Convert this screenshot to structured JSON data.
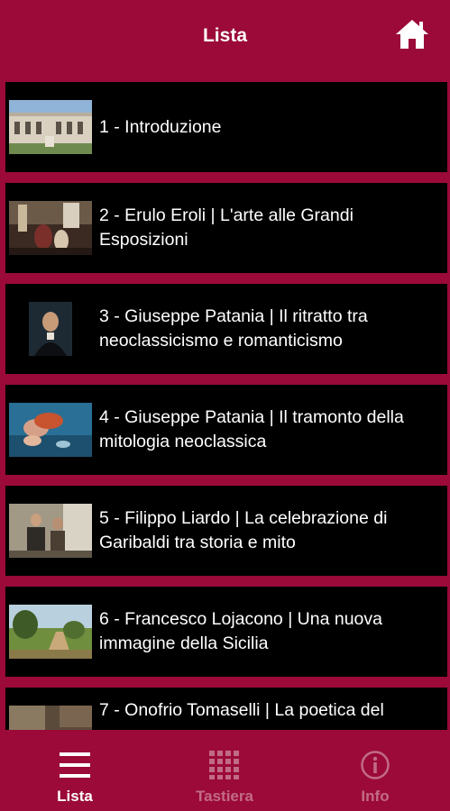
{
  "header": {
    "title": "Lista",
    "home_icon": "home-icon"
  },
  "list": {
    "items": [
      {
        "label": "1 - Introduzione",
        "thumbnail": "cloister-courtyard"
      },
      {
        "label": "2 - Erulo Eroli | L'arte alle Grandi Esposizioni",
        "thumbnail": "painting-interior-scene"
      },
      {
        "label": "3 - Giuseppe Patania | Il ritratto tra neoclassicismo e romanticismo",
        "thumbnail": "portrait-painting"
      },
      {
        "label": "4 - Giuseppe Patania | Il tramonto della mitologia neoclassica",
        "thumbnail": "mythological-painting"
      },
      {
        "label": "5 - Filippo Liardo | La celebrazione di Garibaldi tra storia e mito",
        "thumbnail": "garibaldi-painting"
      },
      {
        "label": "6 - Francesco Lojacono | Una nuova immagine della Sicilia",
        "thumbnail": "landscape-painting"
      },
      {
        "label": "7 - Onofrio Tomaselli | La poetica del",
        "thumbnail": "genre-painting"
      }
    ]
  },
  "bottom_nav": {
    "tabs": [
      {
        "label": "Lista",
        "icon": "list-icon",
        "active": true
      },
      {
        "label": "Tastiera",
        "icon": "keypad-icon",
        "active": false
      },
      {
        "label": "Info",
        "icon": "info-icon",
        "active": false
      }
    ]
  },
  "colors": {
    "brand": "#9b0a38",
    "row_background": "#000000",
    "text": "#ffffff",
    "inactive_tab": "#c26b86"
  }
}
